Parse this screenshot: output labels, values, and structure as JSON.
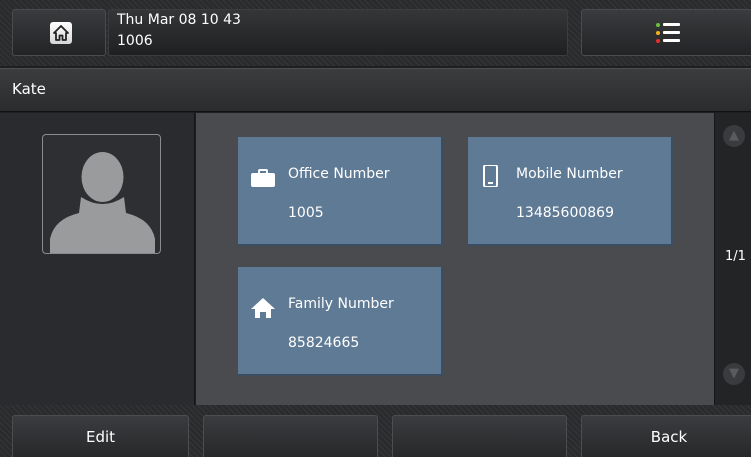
{
  "status_bar": {
    "datetime": "Thu Mar 08 10 43",
    "account": "1006",
    "home_icon": "home-icon",
    "menu_icon": "menu-list-icon",
    "menu_dot_colors": [
      "#6ac23a",
      "#f2b21a",
      "#e8302a"
    ]
  },
  "contact": {
    "name": "Kate",
    "photo_icon": "person-silhouette-icon",
    "numbers": [
      {
        "label": "Office Number",
        "value": "1005",
        "icon": "briefcase-icon"
      },
      {
        "label": "Mobile Number",
        "value": "13485600869",
        "icon": "mobile-phone-icon"
      },
      {
        "label": "Family Number",
        "value": "85824665",
        "icon": "house-icon"
      }
    ]
  },
  "pager": {
    "indicator": "1/1",
    "up_icon": "arrow-up-icon",
    "down_icon": "arrow-down-icon"
  },
  "softkeys": [
    "Edit",
    "",
    "",
    "Back"
  ],
  "colors": {
    "card": "#5f7a94",
    "cards_background": "#4a4b4e"
  }
}
